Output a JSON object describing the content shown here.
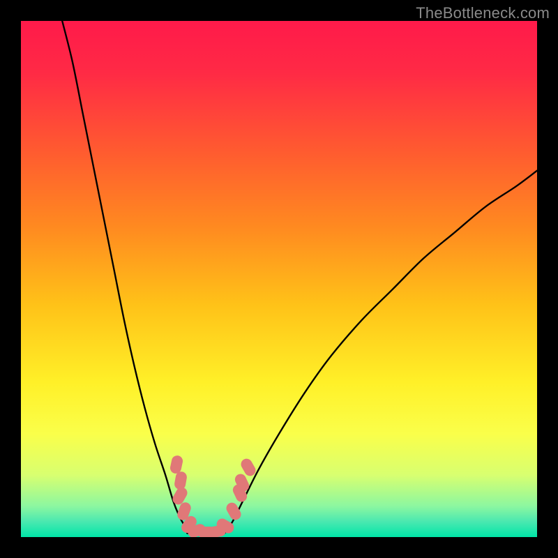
{
  "watermark": "TheBottleneck.com",
  "gradient": {
    "stops": [
      {
        "offset": 0.0,
        "color": "#ff1a4a"
      },
      {
        "offset": 0.1,
        "color": "#ff2a45"
      },
      {
        "offset": 0.25,
        "color": "#ff5a30"
      },
      {
        "offset": 0.4,
        "color": "#ff8a20"
      },
      {
        "offset": 0.55,
        "color": "#ffc218"
      },
      {
        "offset": 0.7,
        "color": "#fff028"
      },
      {
        "offset": 0.8,
        "color": "#faff4a"
      },
      {
        "offset": 0.88,
        "color": "#d8ff70"
      },
      {
        "offset": 0.94,
        "color": "#8cf7a0"
      },
      {
        "offset": 0.97,
        "color": "#4ae8b0"
      },
      {
        "offset": 1.0,
        "color": "#00e6a8"
      }
    ]
  },
  "marker_color": "#e07878",
  "chart_data": {
    "type": "line",
    "title": "",
    "xlabel": "",
    "ylabel": "",
    "xlim": [
      0,
      100
    ],
    "ylim": [
      0,
      100
    ],
    "series": [
      {
        "name": "left_branch",
        "x": [
          8,
          10,
          12,
          14,
          16,
          18,
          20,
          22,
          24,
          26,
          28,
          29.5,
          30.7,
          31.8,
          32.3
        ],
        "y": [
          100,
          92,
          82,
          72,
          62,
          52,
          42,
          33,
          25,
          18,
          12,
          7,
          4,
          2,
          0.8
        ]
      },
      {
        "name": "flat_minimum",
        "x": [
          32.3,
          34,
          36,
          38,
          39.5
        ],
        "y": [
          0.8,
          0.6,
          0.6,
          0.7,
          0.9
        ]
      },
      {
        "name": "right_branch",
        "x": [
          39.5,
          41,
          43,
          46,
          50,
          55,
          60,
          66,
          72,
          78,
          84,
          90,
          96,
          100
        ],
        "y": [
          0.9,
          3,
          7,
          13,
          20,
          28,
          35,
          42,
          48,
          54,
          59,
          64,
          68,
          71
        ]
      }
    ],
    "markers": [
      {
        "x": 30.2,
        "y": 14,
        "rot": 12
      },
      {
        "x": 31.0,
        "y": 11,
        "rot": 10
      },
      {
        "x": 30.8,
        "y": 8,
        "rot": 30
      },
      {
        "x": 31.6,
        "y": 5,
        "rot": 20
      },
      {
        "x": 32.6,
        "y": 2.5,
        "rot": 35
      },
      {
        "x": 34.0,
        "y": 1.2,
        "rot": 70
      },
      {
        "x": 36.0,
        "y": 1.0,
        "rot": 90
      },
      {
        "x": 38.0,
        "y": 1.1,
        "rot": 80
      },
      {
        "x": 39.6,
        "y": 2.2,
        "rot": 120
      },
      {
        "x": 41.2,
        "y": 5.0,
        "rot": 150
      },
      {
        "x": 42.4,
        "y": 8.5,
        "rot": 155
      },
      {
        "x": 42.8,
        "y": 10.5,
        "rot": 155
      },
      {
        "x": 44.0,
        "y": 13.5,
        "rot": 150
      }
    ]
  }
}
